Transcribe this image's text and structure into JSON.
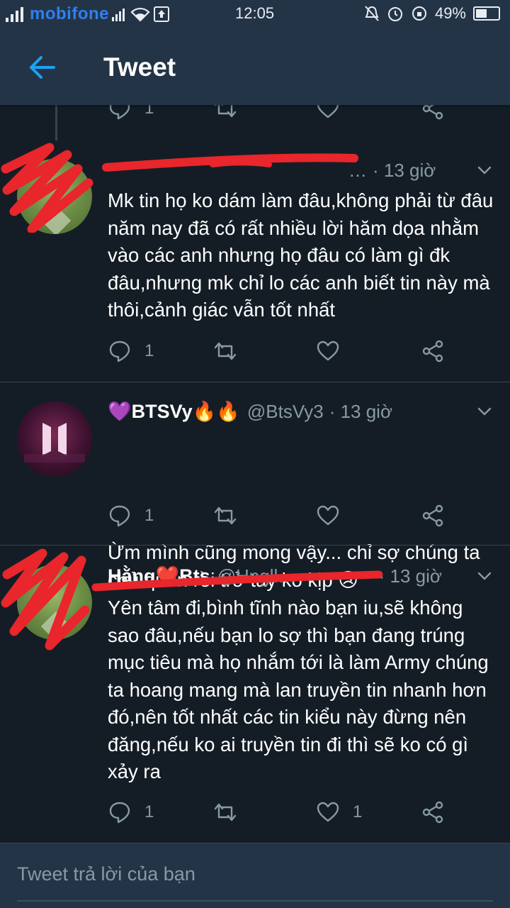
{
  "status_bar": {
    "carrier": "mobifone",
    "time": "12:05",
    "battery": "49%",
    "battery_level": 0.49
  },
  "header": {
    "title": "Tweet",
    "back_icon": "arrow-left-icon",
    "accent_color": "#1da1f2"
  },
  "tweets": [
    {
      "display_name": "",
      "handle": "",
      "time_prefix": "…",
      "time": "· 13 giờ",
      "body": "Mk tin họ ko dám làm đâu,không phải từ đâu năm nay đã có rất nhiều lời hăm dọa nhằm vào các anh nhưng họ đâu có làm gì đk đâu,nhưng mk chỉ lo các anh biết tin này mà thôi,cảnh giác vẫn tốt nhất",
      "replies": "1",
      "retweets": "",
      "likes": ""
    },
    {
      "display_name": "💜BTSVy🔥🔥",
      "handle": "@BtsVy3",
      "time": "· 13 giờ",
      "body": "Ừm mình cũng mong vậy... chỉ sợ chúng ta chủ quan rồi trở tay ko kịp 😢",
      "replies": "1",
      "retweets": "",
      "likes": ""
    },
    {
      "display_name": "Hằng❤️Bts",
      "handle": "@Hngll…",
      "time": "· 13 giờ",
      "body": "Yên tâm đi,bình tĩnh nào bạn iu,sẽ không sao đâu,nếu bạn lo sợ thì bạn đang trúng mục tiêu mà họ nhắm tới là làm Army chúng ta hoang mang mà lan truyền tin nhanh hơn đó,nên tốt nhất các tin kiểu này đừng nên đăng,nếu ko ai truyền tin đi thì sẽ ko có gì xảy ra",
      "replies": "1",
      "retweets": "",
      "likes": "1"
    }
  ],
  "top_partial_actions": {
    "replies": "1"
  },
  "reply_bar": {
    "placeholder": "Tweet trả lời của bạn"
  },
  "colors": {
    "background": "#141d26",
    "header": "#243447",
    "muted": "#8899a6",
    "scribble": "#e8262b"
  }
}
